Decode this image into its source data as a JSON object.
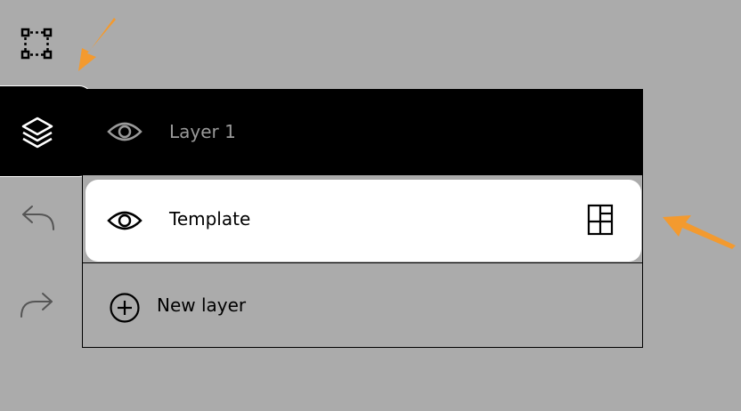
{
  "toolbar": {
    "items": [
      {
        "name": "selection-tool",
        "icon": "selection-icon"
      },
      {
        "name": "layers",
        "icon": "layers-icon",
        "active": true
      },
      {
        "name": "undo",
        "icon": "undo-icon"
      },
      {
        "name": "redo",
        "icon": "redo-icon"
      }
    ]
  },
  "layers_panel": {
    "layers": [
      {
        "label": "Layer 1",
        "visibility_icon": "eye-icon",
        "selected": true
      },
      {
        "label": "Template",
        "visibility_icon": "eye-icon",
        "extra_icon": "template-icon"
      }
    ],
    "new_layer_label": "New layer",
    "new_layer_icon": "plus-circle-icon"
  },
  "colors": {
    "background": "#ababab",
    "active": "#000000",
    "surface": "#ffffff",
    "accent_arrow": "#f39a2f"
  }
}
